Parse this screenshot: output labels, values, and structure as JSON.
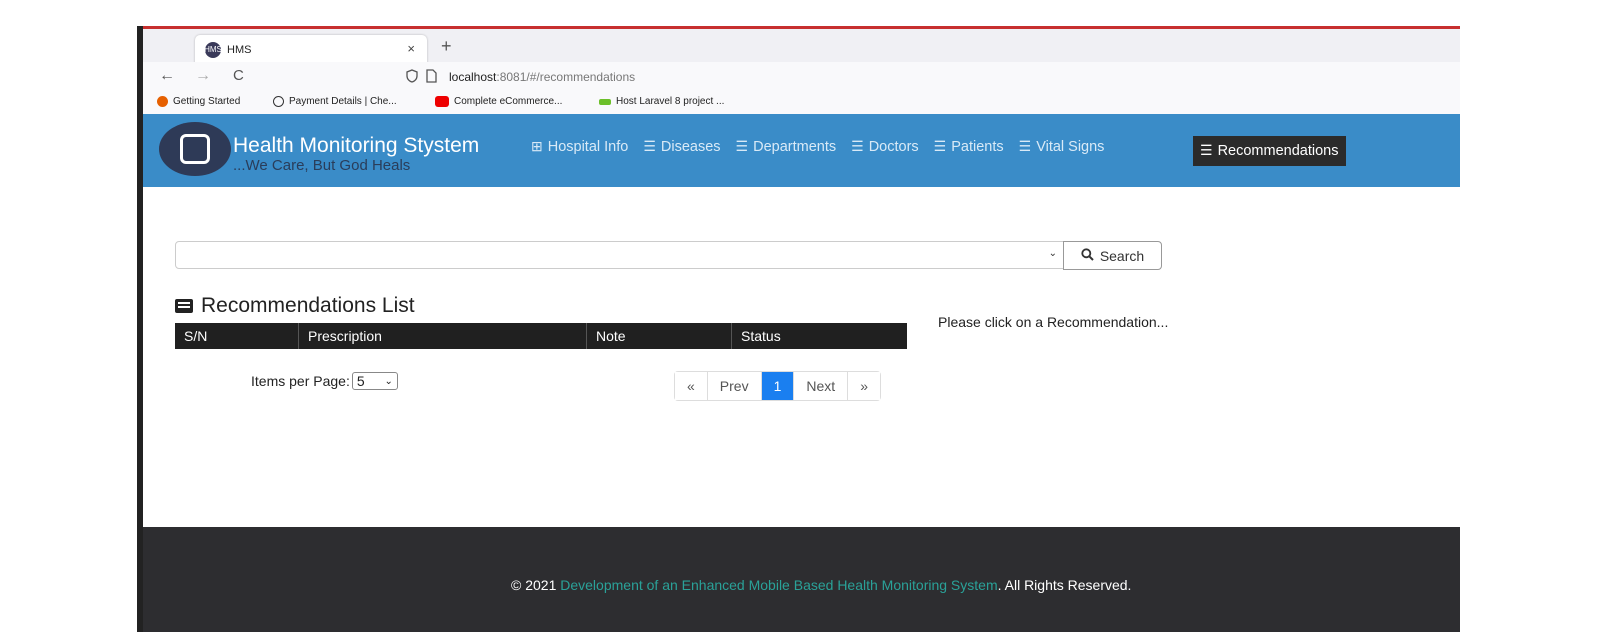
{
  "browser": {
    "tab_title": "HMS",
    "tab_favicon": "HMS",
    "close_glyph": "×",
    "new_tab_glyph": "+",
    "back_glyph": "←",
    "forward_glyph": "→",
    "reload_glyph": "C",
    "url_host": "localhost",
    "url_rest": ":8081/#/recommendations",
    "bookmarks": [
      "Getting Started",
      "Payment Details | Che...",
      "Complete eCommerce...",
      "Host Laravel 8 project ..."
    ]
  },
  "header": {
    "brand": "Health Monitoring Stystem",
    "tagline": "...We Care, But God Heals",
    "menu": [
      {
        "label": "Hospital Info",
        "icon": "table-icon"
      },
      {
        "label": "Diseases",
        "icon": "list-icon"
      },
      {
        "label": "Departments",
        "icon": "list-icon"
      },
      {
        "label": "Doctors",
        "icon": "list-icon"
      },
      {
        "label": "Patients",
        "icon": "list-icon"
      },
      {
        "label": "Vital Signs",
        "icon": "list-icon"
      },
      {
        "label": "Recommendations",
        "icon": "list-icon",
        "active": true
      }
    ]
  },
  "search": {
    "button_label": "Search",
    "selected": ""
  },
  "list": {
    "title": "Recommendations List",
    "columns": [
      "S/N",
      "Prescription",
      "Note",
      "Status"
    ],
    "rows": []
  },
  "pagination": {
    "items_per_page_label": "Items per Page:",
    "items_per_page": "5",
    "first": "«",
    "prev": "Prev",
    "current": "1",
    "next": "Next",
    "last": "»"
  },
  "detail_hint": "Please click on a Recommendation...",
  "footer": {
    "prefix": "© 2021 ",
    "link": "Development of an Enhanced Mobile Based Health Monitoring System",
    "suffix": ". All Rights Reserved."
  },
  "colors": {
    "header_bg": "#3a8cc8",
    "active_menu_bg": "#2b2b2b",
    "table_header_bg": "#202020",
    "page_active": "#1a7ff0",
    "footer_bg": "#2d2d30",
    "footer_link": "#2aa198"
  }
}
